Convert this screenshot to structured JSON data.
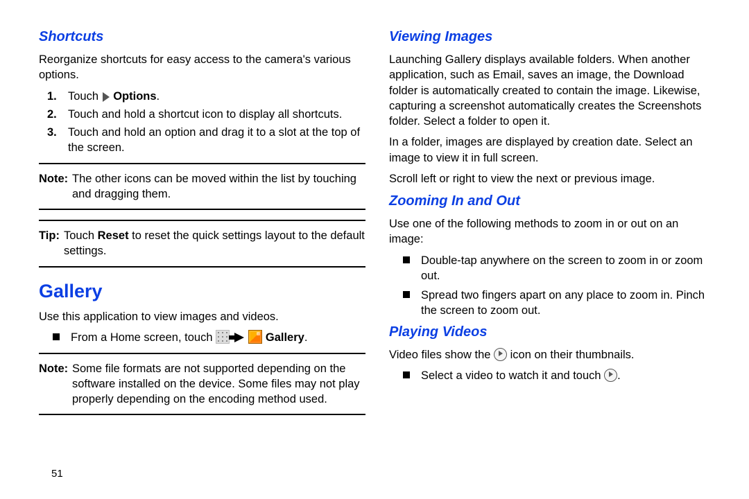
{
  "pageNumber": "51",
  "left": {
    "shortcuts": {
      "heading": "Shortcuts",
      "intro": "Reorganize shortcuts for easy access to the camera's various options.",
      "steps": {
        "s1_pre": "Touch ",
        "s1_bold": "Options",
        "s1_post": ".",
        "s2": "Touch and hold a shortcut icon to display all shortcuts.",
        "s3": "Touch and hold an option and drag it to a slot at the top of the screen."
      },
      "note": {
        "label": "Note:",
        "text": "The other icons can be moved within the list by touching and dragging them."
      },
      "tip": {
        "label": "Tip:",
        "pre": "Touch ",
        "bold": "Reset",
        "post": " to reset the quick settings layout to the default settings."
      }
    },
    "gallery": {
      "heading": "Gallery",
      "intro": "Use this application to view images and videos.",
      "bullet": {
        "pre": "From a Home screen, touch ",
        "bold": "Gallery",
        "post": "."
      },
      "note": {
        "label": "Note:",
        "text": "Some file formats are not supported depending on the software installed on the device. Some files may not play properly depending on the encoding method used."
      }
    }
  },
  "right": {
    "viewing": {
      "heading": "Viewing Images",
      "p1": "Launching Gallery displays available folders. When another application, such as Email, saves an image, the Download folder is automatically created to contain the image. Likewise, capturing a screenshot automatically creates the Screenshots folder. Select a folder to open it.",
      "p2": "In a folder, images are displayed by creation date. Select an image to view it in full screen.",
      "p3": "Scroll left or right to view the next or previous image."
    },
    "zoom": {
      "heading": "Zooming In and Out",
      "intro": "Use one of the following methods to zoom in or out on an image:",
      "b1": "Double-tap anywhere on the screen to zoom in or zoom out.",
      "b2": "Spread two fingers apart on any place to zoom in. Pinch the screen to zoom out."
    },
    "playing": {
      "heading": "Playing Videos",
      "p1_pre": "Video files show the ",
      "p1_post": " icon on their thumbnails.",
      "b1_pre": "Select a video to watch it and touch ",
      "b1_post": "."
    }
  }
}
